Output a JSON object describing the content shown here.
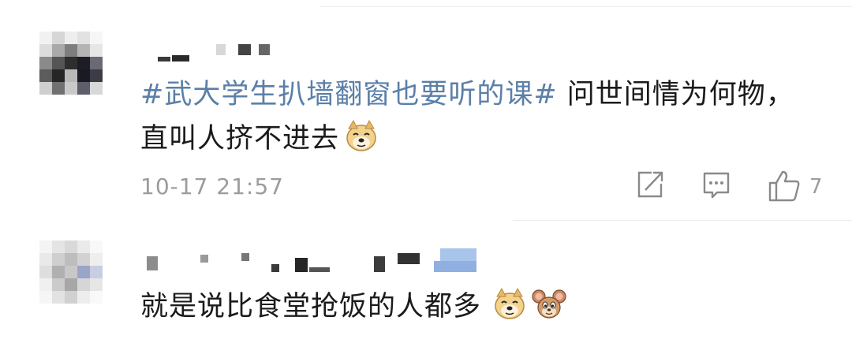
{
  "comments": [
    {
      "topic": "#武大学生扒墙翻窗也要听的课#",
      "text_line1": " 问世间情为何物，",
      "text_line2": "直叫人挤不进去",
      "emojis": [
        "doge-emoji"
      ],
      "timestamp": "10-17 21:57",
      "actions": {
        "share_icon": "share-icon",
        "comment_icon": "comment-icon",
        "like_icon": "thumbs-up-icon",
        "like_count": "7"
      }
    },
    {
      "text": "就是说比食堂抢饭的人都多",
      "emojis": [
        "doge-emoji",
        "jerry-mouse-emoji"
      ]
    }
  ],
  "colors": {
    "topic": "#5b7fa8",
    "text": "#1b1b1b",
    "meta": "#9c9c9c",
    "icon": "#8a8a8a"
  }
}
